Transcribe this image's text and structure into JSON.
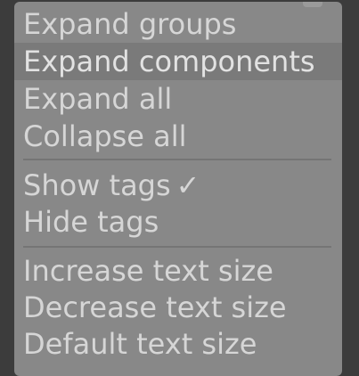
{
  "menu": {
    "group1": [
      {
        "label": "Expand groups",
        "highlighted": false
      },
      {
        "label": "Expand components",
        "highlighted": true
      },
      {
        "label": "Expand all",
        "highlighted": false
      },
      {
        "label": "Collapse all",
        "highlighted": false
      }
    ],
    "group2": [
      {
        "label": "Show tags",
        "checked": true,
        "check_glyph": "✓"
      },
      {
        "label": "Hide tags",
        "checked": false
      }
    ],
    "group3": [
      {
        "label": "Increase text size"
      },
      {
        "label": "Decrease text size"
      },
      {
        "label": "Default text size"
      }
    ]
  },
  "colors": {
    "background": "#3c3c3c",
    "menu_bg": "#888888",
    "highlight_bg": "#7a7a7a",
    "text": "#d6d6d6",
    "separator": "#757575"
  },
  "icons": {
    "check": "checkmark-icon"
  }
}
